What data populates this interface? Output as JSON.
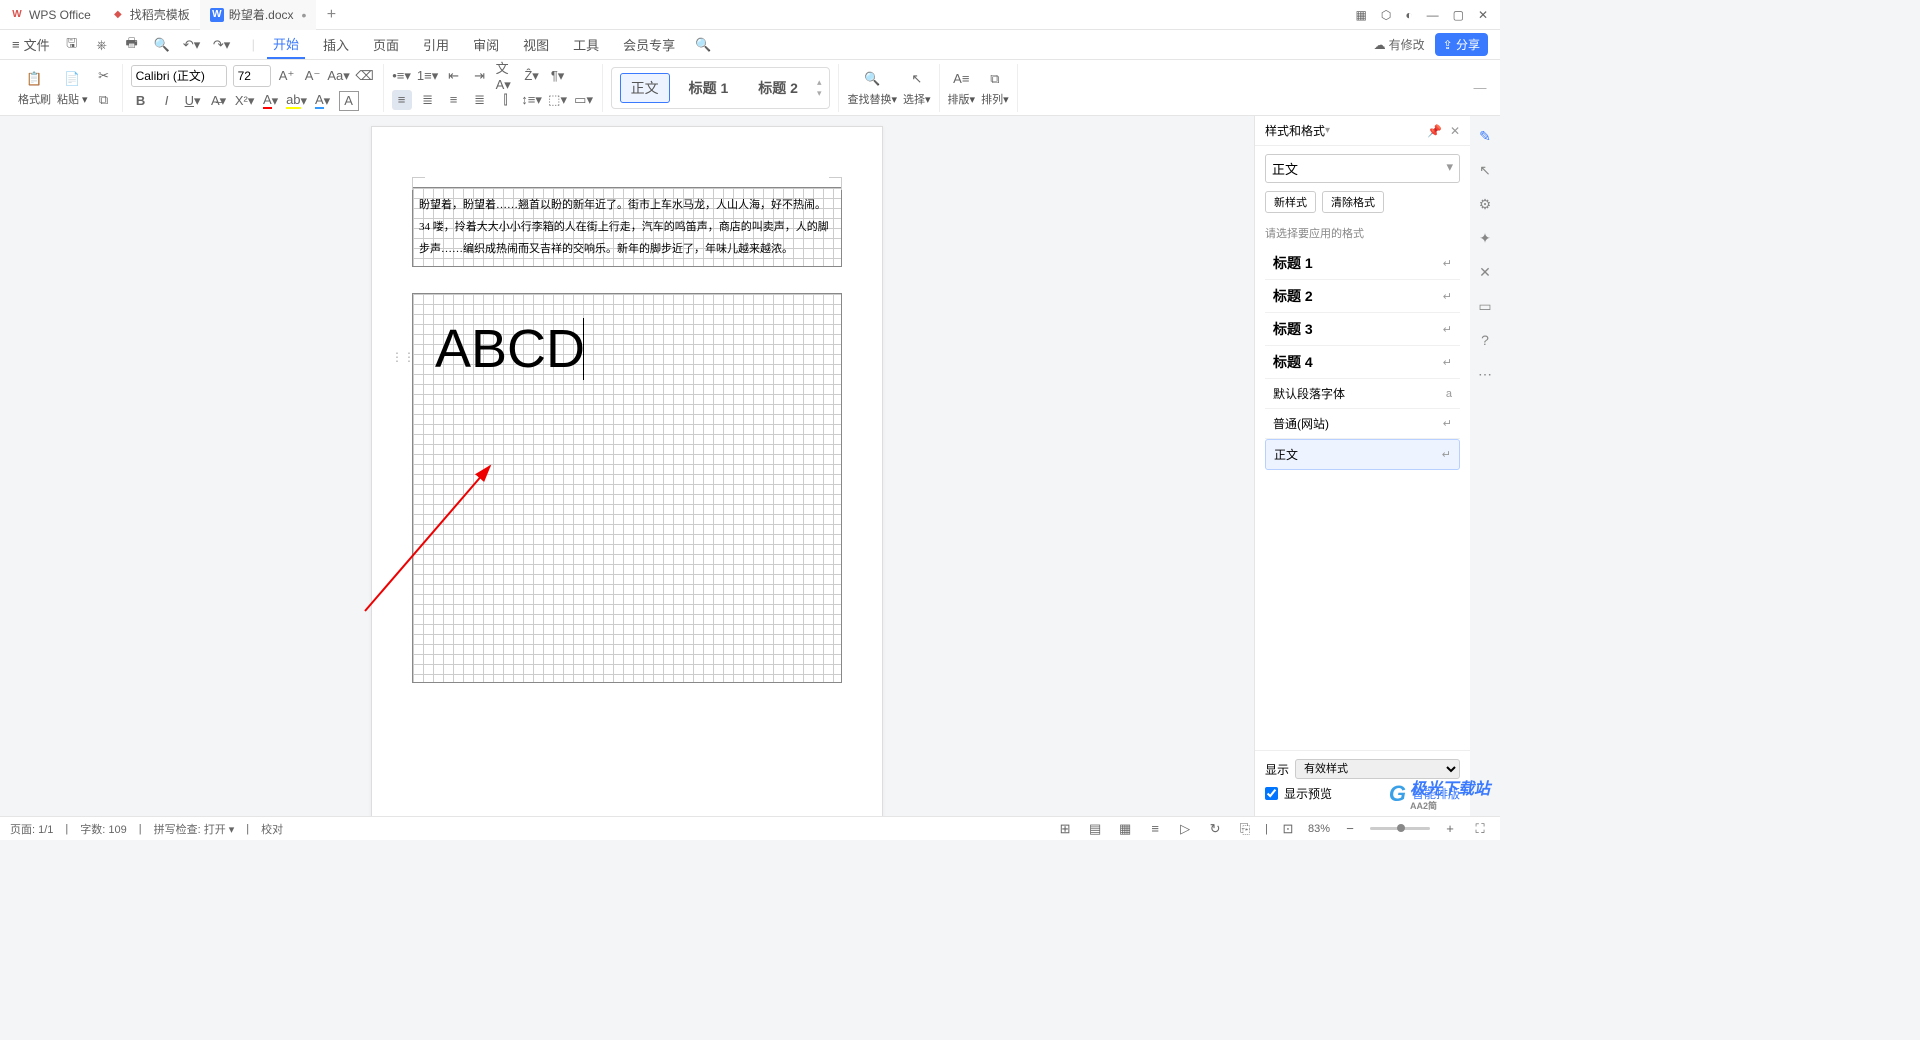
{
  "titlebar": {
    "tabs": [
      {
        "icon": "W",
        "icon_color": "#d9534f",
        "label": "WPS Office"
      },
      {
        "icon": "◆",
        "icon_color": "#d9534f",
        "label": "找稻壳模板"
      },
      {
        "icon": "W",
        "icon_color": "#3a7afe",
        "label": "盼望着.docx"
      }
    ]
  },
  "menubar": {
    "file": "文件",
    "items": [
      "开始",
      "插入",
      "页面",
      "引用",
      "审阅",
      "视图",
      "工具",
      "会员专享"
    ],
    "modify": "有修改",
    "share": "分享"
  },
  "ribbon": {
    "format_painter": "格式刷",
    "paste": "粘贴",
    "font_name": "Calibri (正文)",
    "font_size": "72",
    "styles": [
      "正文",
      "标题 1",
      "标题 2"
    ],
    "find": "查找替换",
    "select": "选择",
    "layout": "排版",
    "arrange": "排列"
  },
  "document": {
    "paragraph": "盼望着，盼望着……翘首以盼的新年近了。街市上车水马龙，人山人海，好不热闹。34 喽，拎着大大小小行李箱的人在街上行走，汽车的鸣笛声，商店的叫卖声，人的脚步声……编织成热闹而又吉祥的交响乐。新年的脚步近了，年味儿越来越浓。",
    "big_text": "ABCD"
  },
  "panel": {
    "title": "样式和格式",
    "current": "正文",
    "new_style": "新样式",
    "clear": "清除格式",
    "hint": "请选择要应用的格式",
    "entries": [
      {
        "name": "标题 1",
        "ret": "↵"
      },
      {
        "name": "标题 2",
        "ret": "↵"
      },
      {
        "name": "标题 3",
        "ret": "↵"
      },
      {
        "name": "标题 4",
        "ret": "↵"
      },
      {
        "name": "默认段落字体",
        "ret": "a",
        "small": true
      },
      {
        "name": "普通(网站)",
        "ret": "↵",
        "small": true
      },
      {
        "name": "正文",
        "ret": "↵",
        "small": true,
        "selected": true
      }
    ],
    "show_label": "显示",
    "show_value": "有效样式",
    "preview": "显示预览",
    "smart": "智能排版"
  },
  "statusbar": {
    "page": "页面: 1/1",
    "words": "字数: 109",
    "spell": "拼写检查: 打开",
    "proof": "校对",
    "zoom": "83%"
  },
  "watermark": {
    "main": "极光下载站",
    "sub": "AA2简"
  }
}
